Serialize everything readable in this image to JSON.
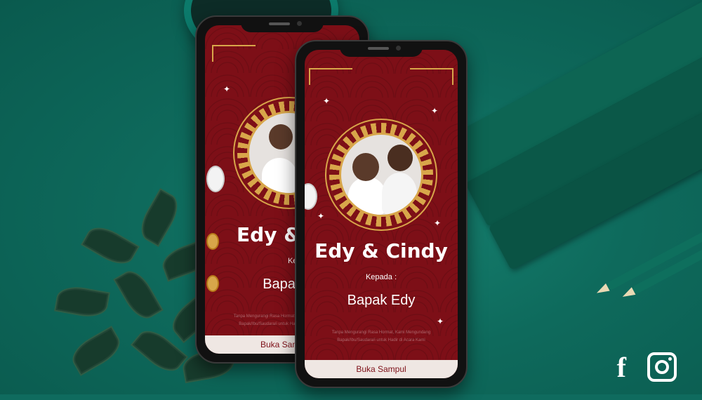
{
  "back_phone": {
    "couple": "Edy & C",
    "kepada": "Kepada :",
    "guest": "Bapak E",
    "note": "Tanpa Mengurangi Rasa Hormat, Kami Mengundang Bapak/Ibu/Saudara/i untuk Hadir di Acara Kami",
    "open_button": "Buka Samp"
  },
  "front_phone": {
    "couple": "Edy & Cindy",
    "kepada": "Kepada :",
    "guest": "Bapak Edy",
    "note": "Tanpa Mengurangi Rasa Hormat, Kami Mengundang Bapak/Ibu/Saudara/i untuk Hadir di Acara Kami",
    "open_button": "Buka Sampul"
  },
  "social": {
    "facebook_icon": "f",
    "icons": [
      "facebook-icon",
      "instagram-icon"
    ]
  },
  "colors": {
    "background": "#0f6b5e",
    "card_red": "#7d0f17",
    "gold": "#d8a64a",
    "button_bg": "#efe7e3"
  }
}
